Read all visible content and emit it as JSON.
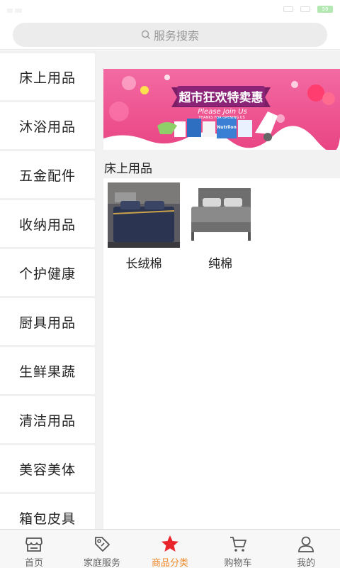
{
  "search": {
    "placeholder": "服务搜索"
  },
  "status": {
    "battery": "59"
  },
  "sidebar": {
    "items": [
      {
        "label": "床上用品"
      },
      {
        "label": "沐浴用品"
      },
      {
        "label": "五金配件"
      },
      {
        "label": "收纳用品"
      },
      {
        "label": "个护健康"
      },
      {
        "label": "厨具用品"
      },
      {
        "label": "生鲜果蔬"
      },
      {
        "label": "清洁用品"
      },
      {
        "label": "美容美体"
      },
      {
        "label": "箱包皮具"
      }
    ]
  },
  "banner": {
    "title": "超市狂欢特卖惠",
    "subtitle": "Please Join Us",
    "tagline": "THANKS FOR OPENING US",
    "brand": "Nutrilon"
  },
  "category": {
    "title": "床上用品",
    "products": [
      {
        "name": "长绒棉"
      },
      {
        "name": "纯棉"
      }
    ]
  },
  "tabbar": {
    "tabs": [
      {
        "label": "首页",
        "icon": "store-icon"
      },
      {
        "label": "家庭服务",
        "icon": "tag-icon"
      },
      {
        "label": "商品分类",
        "icon": "star-icon"
      },
      {
        "label": "购物车",
        "icon": "cart-icon"
      },
      {
        "label": "我的",
        "icon": "user-icon"
      }
    ],
    "active_index": 2
  },
  "colors": {
    "accent": "#f08a2c",
    "active_star": "#e8252d",
    "banner_pink": "#f0568f"
  }
}
